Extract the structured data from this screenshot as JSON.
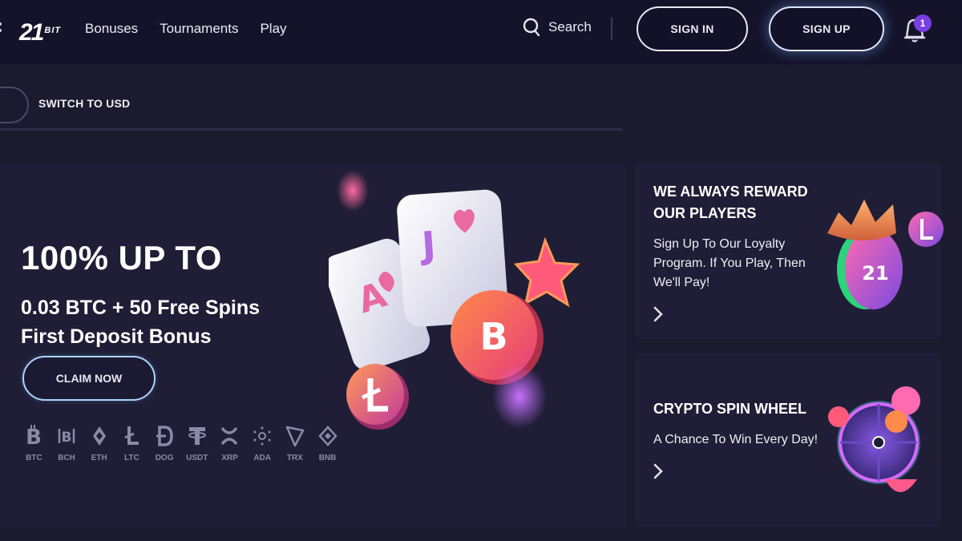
{
  "header": {
    "logo_number": "21",
    "logo_suffix": "BIT",
    "nav": [
      "Bonuses",
      "Tournaments",
      "Play"
    ],
    "search_label": "Search",
    "signin_label": "SIGN IN",
    "signup_label": "SIGN UP",
    "notification_count": "1"
  },
  "subbar": {
    "switch_label": "SWITCH TO USD"
  },
  "hero": {
    "title": "100% UP TO",
    "subtitle_line1": "0.03 BTC + 50 Free Spins",
    "subtitle_line2": "First Deposit Bonus",
    "cta_label": "CLAIM NOW",
    "coins": [
      "BTC",
      "BCH",
      "ETH",
      "LTC",
      "DOG",
      "USDT",
      "XRP",
      "ADA",
      "TRX",
      "BNB"
    ],
    "card_letters": [
      "A",
      "J"
    ],
    "coin_badges": [
      "B"
    ]
  },
  "cards": {
    "loyalty": {
      "title_line1": "WE ALWAYS REWARD",
      "title_line2": "OUR PLAYERS",
      "text_line1": "Sign Up To Our Loyalty",
      "text_line2": "Program. If You Play, Then",
      "text_line3": "We'll Pay!",
      "badge": "21"
    },
    "spin": {
      "title": "CRYPTO SPIN WHEEL",
      "text": "A Chance To Win Every Day!"
    }
  },
  "colors": {
    "background": "#1b1a2e",
    "header": "#14132a",
    "panel": "#1f1e36",
    "accent_purple": "#7a3ee3",
    "coin_orange": "#f06a3b",
    "coin_pink": "#e0509a"
  }
}
